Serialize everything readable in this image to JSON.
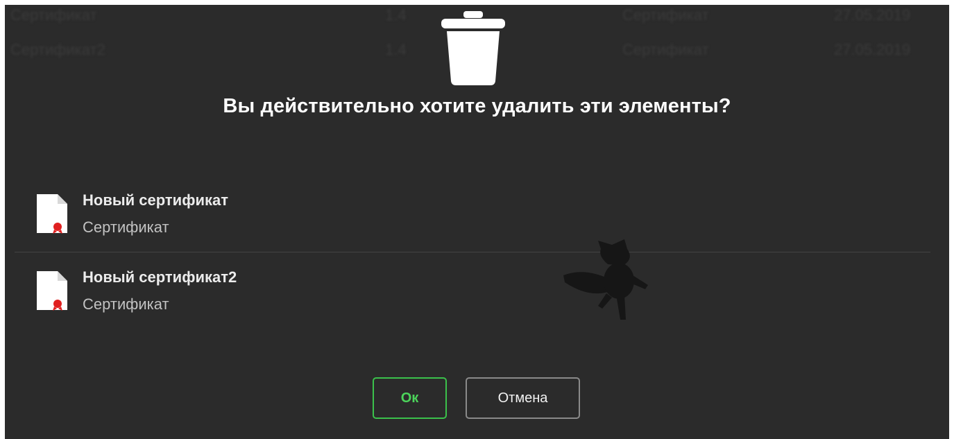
{
  "background_table": {
    "rows": [
      {
        "c1": "Сертификат",
        "c2": "1.4",
        "c3": "Сертификат",
        "c4": "27.05.2019"
      },
      {
        "c1": "Сертификат2",
        "c2": "1.4",
        "c3": "Сертификат",
        "c4": "27.05.2019"
      }
    ]
  },
  "dialog": {
    "icon": "trash-icon",
    "title": "Вы действительно хотите удалить эти элементы?",
    "items": [
      {
        "name": "Новый сертификат",
        "type": "Сертификат",
        "icon": "certificate-file-icon"
      },
      {
        "name": "Новый сертификат2",
        "type": "Сертификат",
        "icon": "certificate-file-icon"
      }
    ],
    "ok_label": "Ок",
    "cancel_label": "Отмена"
  },
  "colors": {
    "background": "#2b2b2b",
    "ok_border": "#3bc24b",
    "cancel_border": "#8a8a8a",
    "seal": "#e02020"
  }
}
